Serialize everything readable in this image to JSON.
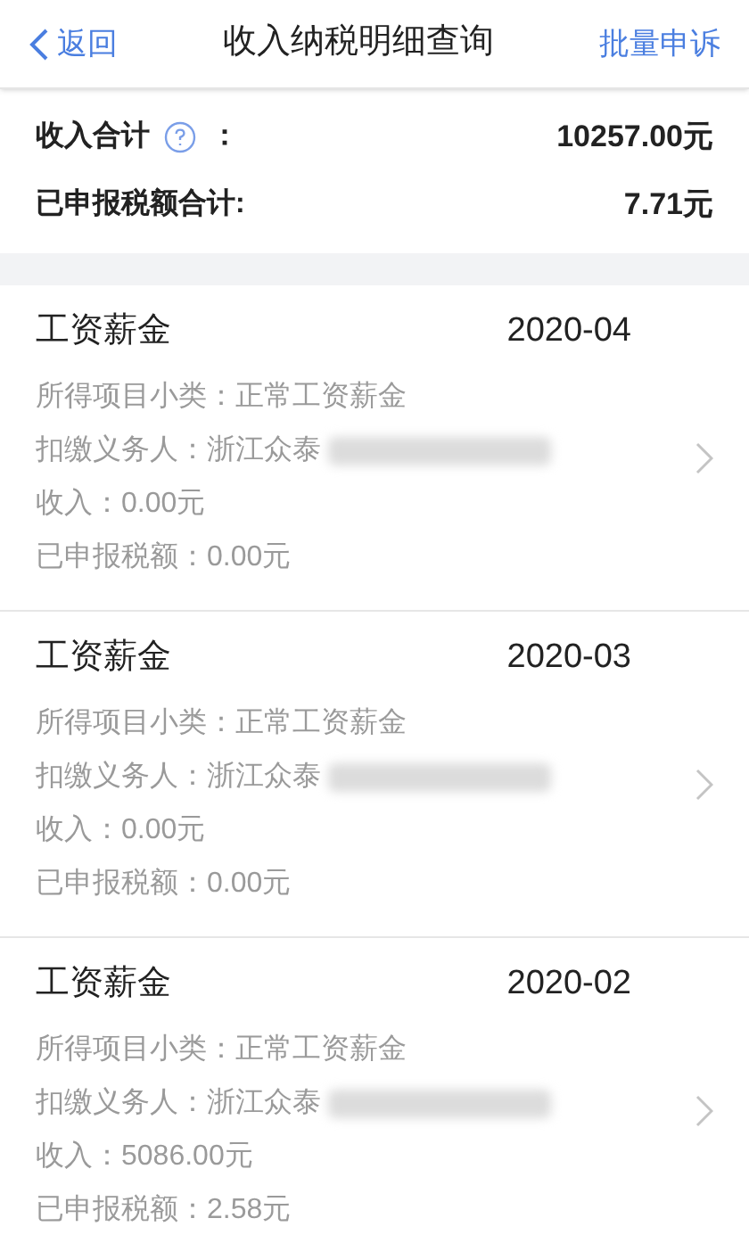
{
  "nav": {
    "back": "返回",
    "title": "收入纳税明细查询",
    "action": "批量申诉"
  },
  "summary": [
    {
      "label": "收入合计",
      "help": true,
      "colon": "：",
      "value": "10257.00元"
    },
    {
      "label": "已申报税额合计:",
      "help": false,
      "value": "7.71元"
    }
  ],
  "records": [
    {
      "type": "工资薪金",
      "period": "2020-04",
      "subcategory": "所得项目小类：正常工资薪金",
      "withholder": "扣缴义务人：浙江众泰",
      "income": "收入：0.00元",
      "tax": "已申报税额：0.00元"
    },
    {
      "type": "工资薪金",
      "period": "2020-03",
      "subcategory": "所得项目小类：正常工资薪金",
      "withholder": "扣缴义务人：浙江众泰",
      "income": "收入：0.00元",
      "tax": "已申报税额：0.00元"
    },
    {
      "type": "工资薪金",
      "period": "2020-02",
      "subcategory": "所得项目小类：正常工资薪金",
      "withholder": "扣缴义务人：浙江众泰",
      "income": "收入：5086.00元",
      "tax": "已申报税额：2.58元"
    }
  ]
}
